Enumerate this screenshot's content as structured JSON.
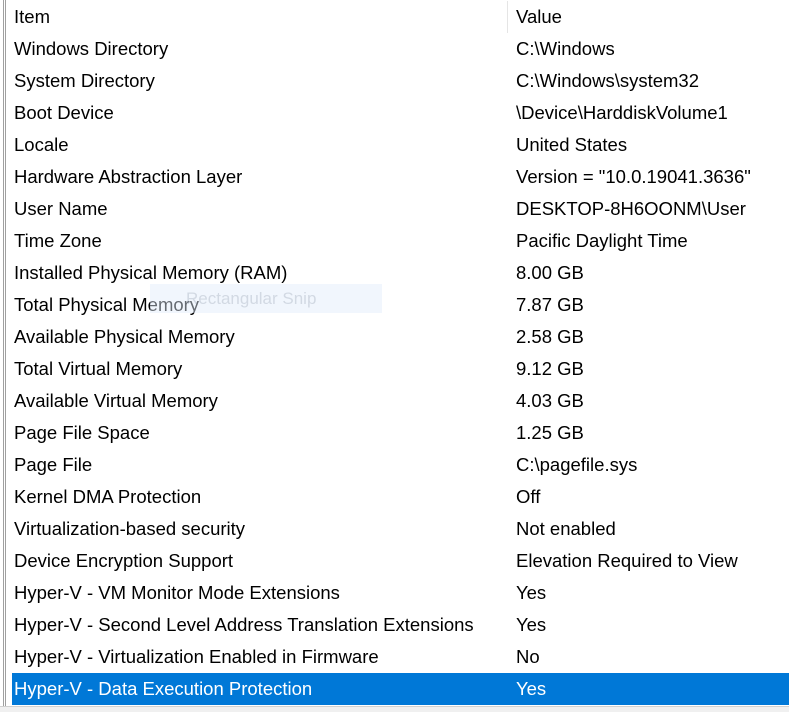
{
  "columns": {
    "item": "Item",
    "value": "Value"
  },
  "rows": [
    {
      "item": "Windows Directory",
      "value": "C:\\Windows"
    },
    {
      "item": "System Directory",
      "value": "C:\\Windows\\system32"
    },
    {
      "item": "Boot Device",
      "value": "\\Device\\HarddiskVolume1"
    },
    {
      "item": "Locale",
      "value": "United States"
    },
    {
      "item": "Hardware Abstraction Layer",
      "value": "Version = \"10.0.19041.3636\""
    },
    {
      "item": "User Name",
      "value": "DESKTOP-8H6OONM\\User"
    },
    {
      "item": "Time Zone",
      "value": "Pacific Daylight Time"
    },
    {
      "item": "Installed Physical Memory (RAM)",
      "value": "8.00 GB"
    },
    {
      "item": "Total Physical Memory",
      "value": "7.87 GB"
    },
    {
      "item": "Available Physical Memory",
      "value": "2.58 GB"
    },
    {
      "item": "Total Virtual Memory",
      "value": "9.12 GB"
    },
    {
      "item": "Available Virtual Memory",
      "value": "4.03 GB"
    },
    {
      "item": "Page File Space",
      "value": "1.25 GB"
    },
    {
      "item": "Page File",
      "value": "C:\\pagefile.sys"
    },
    {
      "item": "Kernel DMA Protection",
      "value": "Off"
    },
    {
      "item": "Virtualization-based security",
      "value": "Not enabled"
    },
    {
      "item": "Device Encryption Support",
      "value": "Elevation Required to View"
    },
    {
      "item": "Hyper-V - VM Monitor Mode Extensions",
      "value": "Yes"
    },
    {
      "item": "Hyper-V - Second Level Address Translation Extensions",
      "value": "Yes"
    },
    {
      "item": "Hyper-V - Virtualization Enabled in Firmware",
      "value": "No"
    },
    {
      "item": "Hyper-V - Data Execution Protection",
      "value": "Yes",
      "selected": true
    }
  ],
  "ghost_tooltip": "Rectangular Snip",
  "colors": {
    "selection": "#0078d7"
  }
}
